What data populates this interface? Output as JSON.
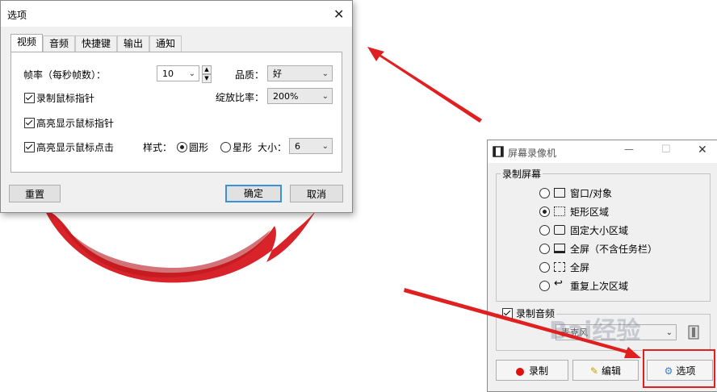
{
  "options_dialog": {
    "title": "选项",
    "close": "✕",
    "tabs": [
      "视频",
      "音频",
      "快捷键",
      "输出",
      "通知"
    ],
    "active_tab": "视频",
    "framerate_label": "帧率（每秒帧数）：",
    "framerate_value": "10",
    "quality_label": "品质：",
    "quality_value": "好",
    "record_cursor_label": "录制鼠标指针",
    "zoom_label": "绽放比率：",
    "zoom_value": "200%",
    "highlight_cursor_label": "高亮显示鼠标指针",
    "highlight_click_label": "高亮显示鼠标点击",
    "style_label": "样式：",
    "style_circle": "圆形",
    "style_star": "星形",
    "size_label": "大小：",
    "size_value": "6",
    "reset_button": "重置",
    "ok_button": "确定",
    "cancel_button": "取消"
  },
  "recorder": {
    "title": "屏幕录像机",
    "minimize": "—",
    "maximize": "☐",
    "close": "✕",
    "group_screen": "录制屏幕",
    "modes": [
      {
        "label": "窗口/对象",
        "icon": "window-icon",
        "selected": false
      },
      {
        "label": "矩形区域",
        "icon": "rect-region-icon",
        "selected": true
      },
      {
        "label": "固定大小区域",
        "icon": "fixed-size-icon",
        "selected": false
      },
      {
        "label": "全屏（不含任务栏）",
        "icon": "fullscreen-no-taskbar-icon",
        "selected": false
      },
      {
        "label": "全屏",
        "icon": "fullscreen-icon",
        "selected": false
      },
      {
        "label": "重复上次区域",
        "icon": "repeat-region-icon",
        "selected": false
      }
    ],
    "audio_label": "录制音频",
    "audio_device": "麦克风",
    "record_button": "录制",
    "edit_button": "编辑",
    "options_button": "选项"
  },
  "watermark": "Bai经验",
  "colors": {
    "annotation_red": "#e02020",
    "brush_red": "#d9232a",
    "default_button_border": "#3c8fd9"
  }
}
